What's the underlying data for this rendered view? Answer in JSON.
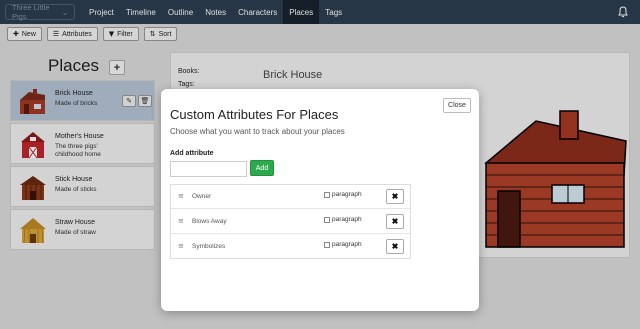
{
  "nav": {
    "story": "Three Little Pigs",
    "items": [
      {
        "label": "Project",
        "name": "project",
        "active": false
      },
      {
        "label": "Timeline",
        "name": "timeline",
        "active": false
      },
      {
        "label": "Outline",
        "name": "outline",
        "active": false
      },
      {
        "label": "Notes",
        "name": "notes",
        "active": false
      },
      {
        "label": "Characters",
        "name": "characters",
        "active": false
      },
      {
        "label": "Places",
        "name": "places",
        "active": true
      },
      {
        "label": "Tags",
        "name": "tags",
        "active": false
      }
    ],
    "bell_icon": "bell-icon"
  },
  "toolbar": {
    "new_label": "New",
    "attributes_label": "Attributes",
    "filter_label": "Filter",
    "sort_label": "Sort"
  },
  "places_panel": {
    "title": "Places",
    "add_label": "+",
    "items": [
      {
        "name": "Brick House",
        "desc": "Made of bricks",
        "selected": true,
        "wall": "#a63a26",
        "roof": "#7c2a1b"
      },
      {
        "name": "Mother's House",
        "desc": "The three pigs' childhood home",
        "selected": false,
        "wall": "#c0262c",
        "roof": "#8e1c1c"
      },
      {
        "name": "Stick House",
        "desc": "Made of sticks",
        "selected": false,
        "wall": "#8a3a1a",
        "roof": "#6a2a10"
      },
      {
        "name": "Straw House",
        "desc": "Made of straw",
        "selected": false,
        "wall": "#d9a43b",
        "roof": "#c08a25"
      }
    ]
  },
  "detail": {
    "books_label": "Books:",
    "tags_label": "Tags:",
    "name": "Brick House"
  },
  "modal": {
    "close_label": "Close",
    "title": "Custom Attributes For Places",
    "subtitle": "Choose what you want to track about your places",
    "add_label": "Add attribute",
    "add_input_value": "",
    "add_button_label": "Add",
    "paragraph_label": "paragraph",
    "delete_label": "✖",
    "attributes": [
      {
        "name": "Owner"
      },
      {
        "name": "Blows Away"
      },
      {
        "name": "Symbolizes"
      }
    ]
  },
  "colors": {
    "navbar": "#2c3e50",
    "selected_place": "#b4c4d6",
    "add_button": "#2ca94e"
  }
}
